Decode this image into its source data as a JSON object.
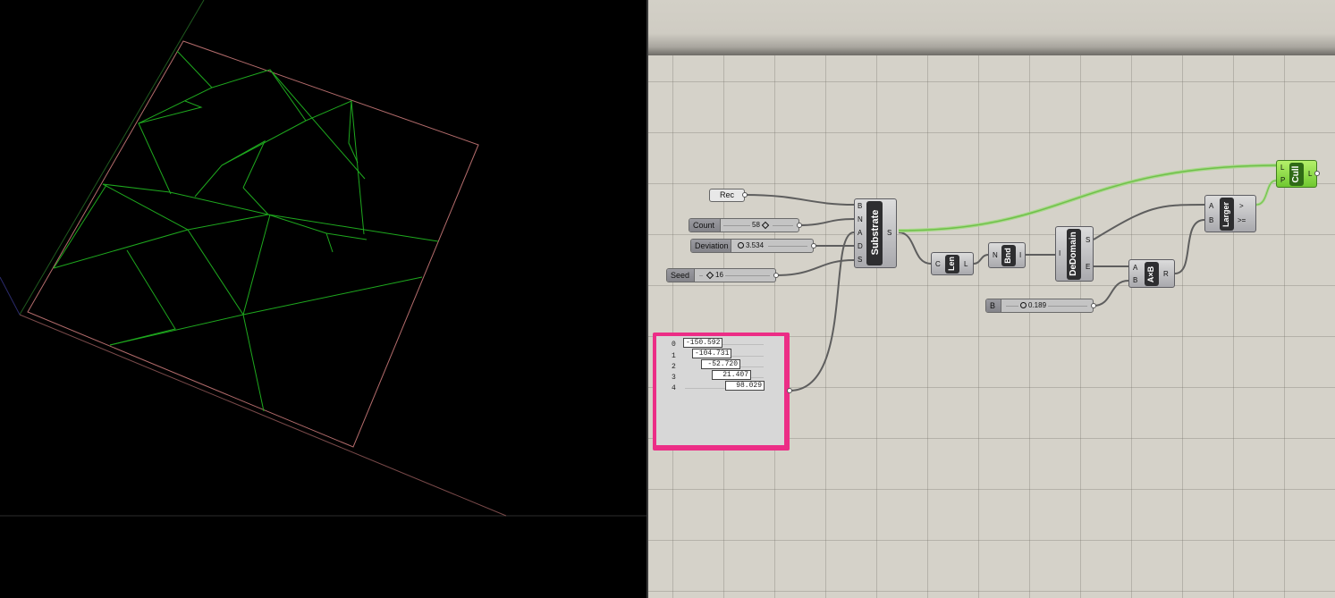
{
  "colors": {
    "viewport_bg": "#000000",
    "canvas_bg": "#d5d2c9",
    "green_geometry": "#1ea81e",
    "boundary": "#b46c6c",
    "panel_border": "#ec2d86",
    "cull_component": "#8fdc3c"
  },
  "components": {
    "substrate": {
      "label": "Substrate",
      "inputs": [
        "B",
        "N",
        "A",
        "D",
        "S"
      ],
      "output": "S"
    },
    "len": {
      "label": "Len",
      "input": "C",
      "output": "L"
    },
    "bnd": {
      "label": "Bnd",
      "input": "N",
      "output": "I"
    },
    "dedomain": {
      "label": "DeDomain",
      "input": "I",
      "outputs": [
        "S",
        "E"
      ]
    },
    "multiply": {
      "label": "A×B",
      "inputs": [
        "A",
        "B"
      ],
      "output": "R"
    },
    "larger": {
      "label": "Larger",
      "inputs": [
        "A",
        "B"
      ],
      "outputs": [
        ">",
        ">="
      ]
    },
    "cull": {
      "label": "Cull",
      "inputs": [
        "L",
        "P"
      ],
      "output": "L"
    }
  },
  "params": {
    "rec": {
      "label": "Rec"
    }
  },
  "sliders": {
    "count": {
      "name": "Count",
      "value": "58"
    },
    "deviation": {
      "name": "Deviation",
      "value": "3.534"
    },
    "seed": {
      "name": "Seed",
      "value": "16"
    },
    "b": {
      "name": "B",
      "value": "0.189"
    }
  },
  "panel": {
    "rows": [
      {
        "index": "0",
        "value": "-150.592"
      },
      {
        "index": "1",
        "value": "-104.731"
      },
      {
        "index": "2",
        "value": "-52.720"
      },
      {
        "index": "3",
        "value": "21.407"
      },
      {
        "index": "4",
        "value": "98.029"
      }
    ]
  }
}
